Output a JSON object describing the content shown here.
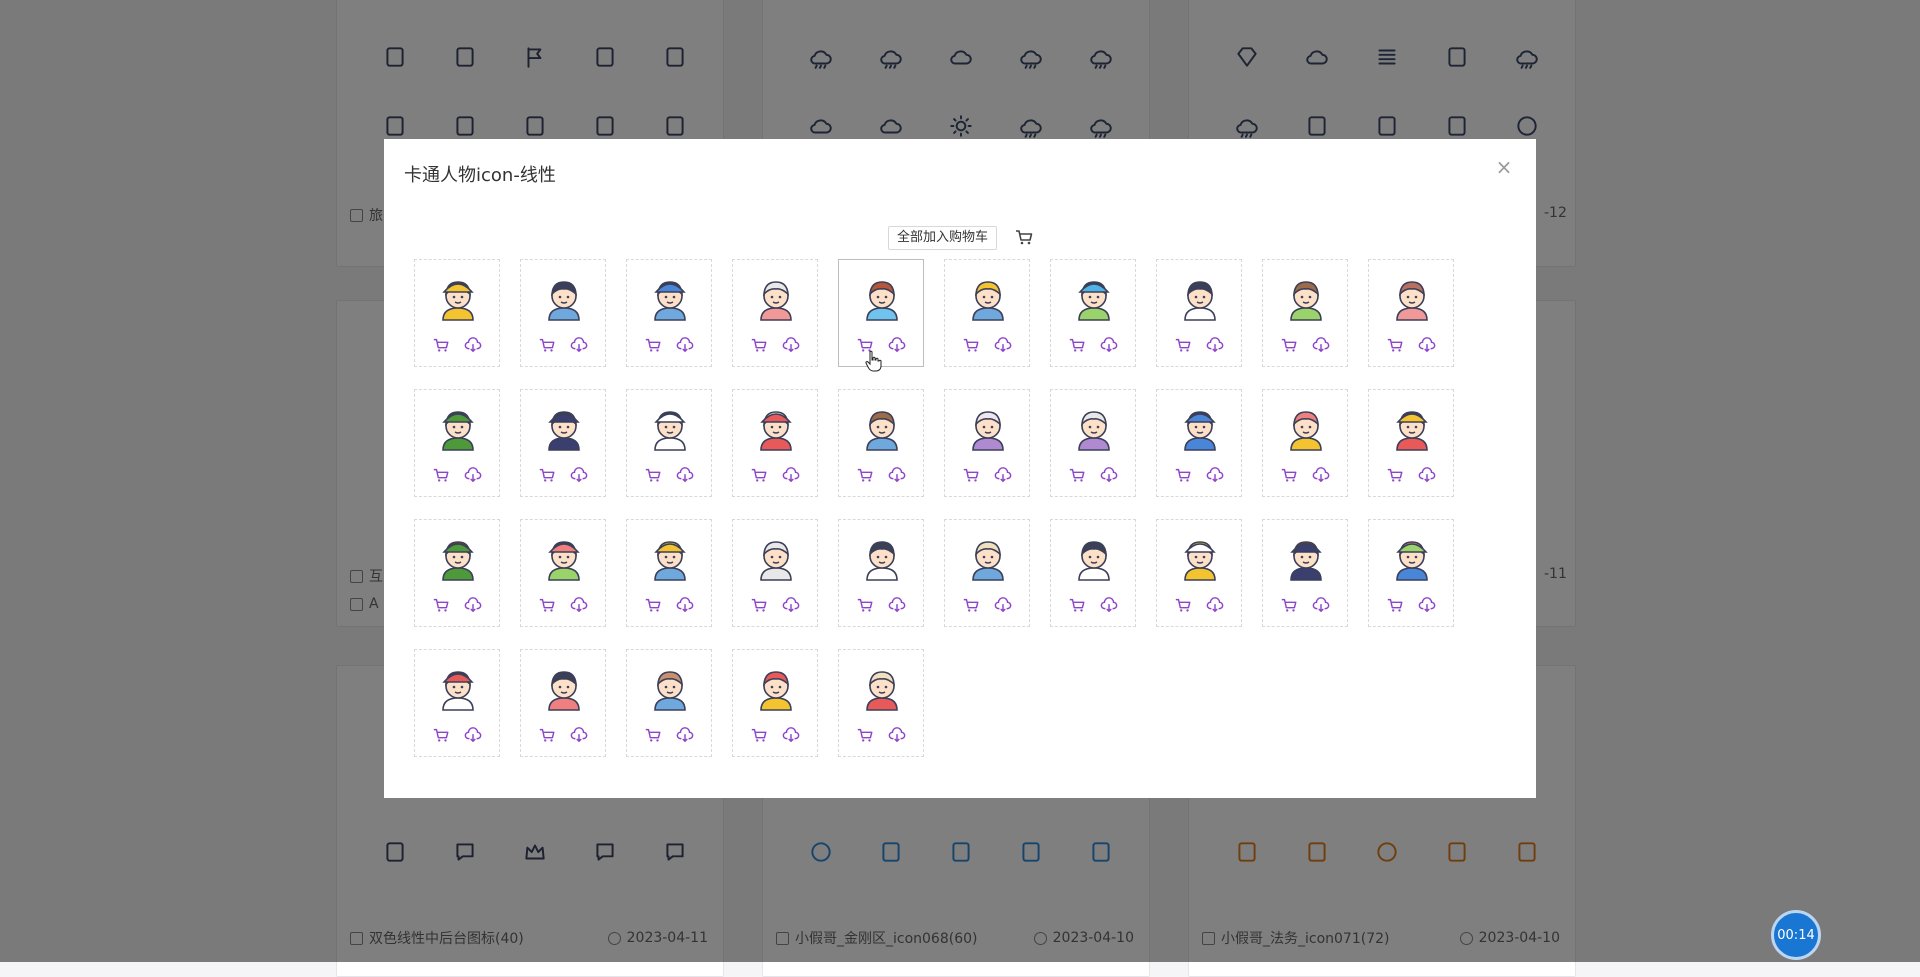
{
  "background": {
    "cards": [
      {
        "icons_row1": [
          "guitar-icon",
          "fuel-pump-icon",
          "flag-icon",
          "dock-icon",
          "pipette-icon"
        ],
        "icons_row2": [
          "microphone-icon",
          "bus-icon",
          "bed-icon",
          "shirt-icon",
          "cup-icon"
        ],
        "footer_partial": "旅",
        "icon_color": "#3a4260"
      },
      {
        "icons_row1": [
          "cloud-rain-icon",
          "cloud-snow-icon",
          "cloud-icon",
          "cloud-rain-icon",
          "cloud-rain-icon"
        ],
        "icons_row2": [
          "cloud-moon-icon",
          "cloud-sun-icon",
          "sun-icon",
          "cloud-rain-icon",
          "cloud-rain-icon"
        ],
        "icon_color": "#3a4a6a"
      },
      {
        "icons_row1": [
          "diamond-icon",
          "cloud-icon",
          "list-icon",
          "cabinet-icon",
          "cloud-rain-icon"
        ],
        "icons_row2": [
          "cloud-rain-icon",
          "floppy-icon",
          "printer-icon",
          "boot-icon",
          "washer-icon"
        ],
        "date": "-12",
        "icon_color": "#3a4a6a"
      }
    ],
    "mid_row": {
      "left_partial": "互",
      "left_partial2": "A",
      "right_date": "-11"
    },
    "bottom_cards": [
      {
        "icons": [
          "calendar-icon",
          "smile-icon",
          "crown-icon",
          "chat-icon",
          "robot-icon"
        ],
        "title": "双色线性中后台图标(40)",
        "date": "2023-04-11",
        "icon_color": "#3a4260"
      },
      {
        "icons": [
          "globe-icon",
          "graduation-cap-icon",
          "id-card-icon",
          "id-card-icon",
          "wallet-icon"
        ],
        "title": "小假哥_金刚区_icon068(60)",
        "date": "2023-04-10",
        "icon_color": "#2d88d8"
      },
      {
        "icons": [
          "contract-icon",
          "handshake-icon",
          "target-icon",
          "laptop-icon",
          "profile-icon"
        ],
        "title": "小假哥_法务_icon071(72)",
        "date": "2023-04-10",
        "icon_color": "#e07a1a"
      }
    ]
  },
  "modal": {
    "title": "卡通人物icon-线性",
    "add_all_label": "全部加入购物车",
    "close_glyph": "×",
    "hover_index": 4,
    "avatars": [
      {
        "hat": "#f4c430",
        "hair": "#5a3b2a",
        "shirt": "#f4c430"
      },
      {
        "hat": null,
        "hair": "#3b3f58",
        "shirt": "#6fa8dc"
      },
      {
        "hat": "#4a86d8",
        "hair": "#3b3f58",
        "shirt": "#6fa8dc"
      },
      {
        "hat": null,
        "hair": "#e8e8e8",
        "shirt": "#f19999"
      },
      {
        "hat": null,
        "hair": "#b5573a",
        "shirt": "#6fc3ec"
      },
      {
        "hat": null,
        "hair": "#f4c430",
        "shirt": "#6fa8dc"
      },
      {
        "hat": "#4fb3e8",
        "hair": "#3b3f58",
        "shirt": "#9bd36b"
      },
      {
        "hat": null,
        "hair": "#3b3f58",
        "shirt": "#ffffff"
      },
      {
        "hat": null,
        "hair": "#9c6b4a",
        "shirt": "#9bd36b"
      },
      {
        "hat": null,
        "hair": "#b87060",
        "shirt": "#f19999"
      },
      {
        "hat": "#4e9a3a",
        "hair": "#3b3f58",
        "shirt": "#4e9a3a"
      },
      {
        "hat": "#3b3f70",
        "hair": "#3b3f58",
        "shirt": "#3b3f70"
      },
      {
        "hat": "#ffffff",
        "hair": "#3b3f58",
        "shirt": "#ffffff"
      },
      {
        "hat": "#e85a5a",
        "hair": "#ffffff",
        "shirt": "#e85a5a"
      },
      {
        "hat": null,
        "hair": "#9c6b4a",
        "shirt": "#6fa8dc"
      },
      {
        "hat": null,
        "hair": "#f0e6f0",
        "shirt": "#b08ad0"
      },
      {
        "hat": null,
        "hair": "#e8e8e8",
        "shirt": "#b08ad0"
      },
      {
        "hat": "#4a86d8",
        "hair": "#3b3f58",
        "shirt": "#4a86d8"
      },
      {
        "hat": null,
        "hair": "#f08080",
        "shirt": "#f4c430"
      },
      {
        "hat": "#f4c430",
        "hair": "#3b3f58",
        "shirt": "#e85a5a"
      },
      {
        "hat": "#4e9a3a",
        "hair": "#7a3b2a",
        "shirt": "#4e9a3a"
      },
      {
        "hat": "#f08080",
        "hair": "#3b3f58",
        "shirt": "#9bd36b"
      },
      {
        "hat": "#f4c430",
        "hair": "#f4c430",
        "shirt": "#6fa8dc"
      },
      {
        "hat": null,
        "hair": "#e8e8e8",
        "shirt": "#e8e8e8"
      },
      {
        "hat": null,
        "hair": "#3b3f58",
        "shirt": "#ffffff"
      },
      {
        "hat": null,
        "hair": "#f0e0c0",
        "shirt": "#6fa8dc"
      },
      {
        "hat": null,
        "hair": "#3b3f58",
        "shirt": "#ffffff"
      },
      {
        "hat": "#ffffff",
        "hair": "#f4c430",
        "shirt": "#f4c430"
      },
      {
        "hat": "#3b3f70",
        "hair": "#7a3b2a",
        "shirt": "#3b3f70"
      },
      {
        "hat": "#9bd36b",
        "hair": "#f08080",
        "shirt": "#4a86d8"
      },
      {
        "hat": "#e85a5a",
        "hair": "#3b3f58",
        "shirt": "#ffffff"
      },
      {
        "hat": null,
        "hair": "#3b3f58",
        "shirt": "#f08080"
      },
      {
        "hat": null,
        "hair": "#c89070",
        "shirt": "#6fa8dc"
      },
      {
        "hat": null,
        "hair": "#e85a5a",
        "shirt": "#f4c430"
      },
      {
        "hat": null,
        "hair": "#f0e0c0",
        "shirt": "#e85a5a"
      }
    ],
    "action_color": "#8e44c8"
  },
  "timer": {
    "label": "00:14"
  }
}
